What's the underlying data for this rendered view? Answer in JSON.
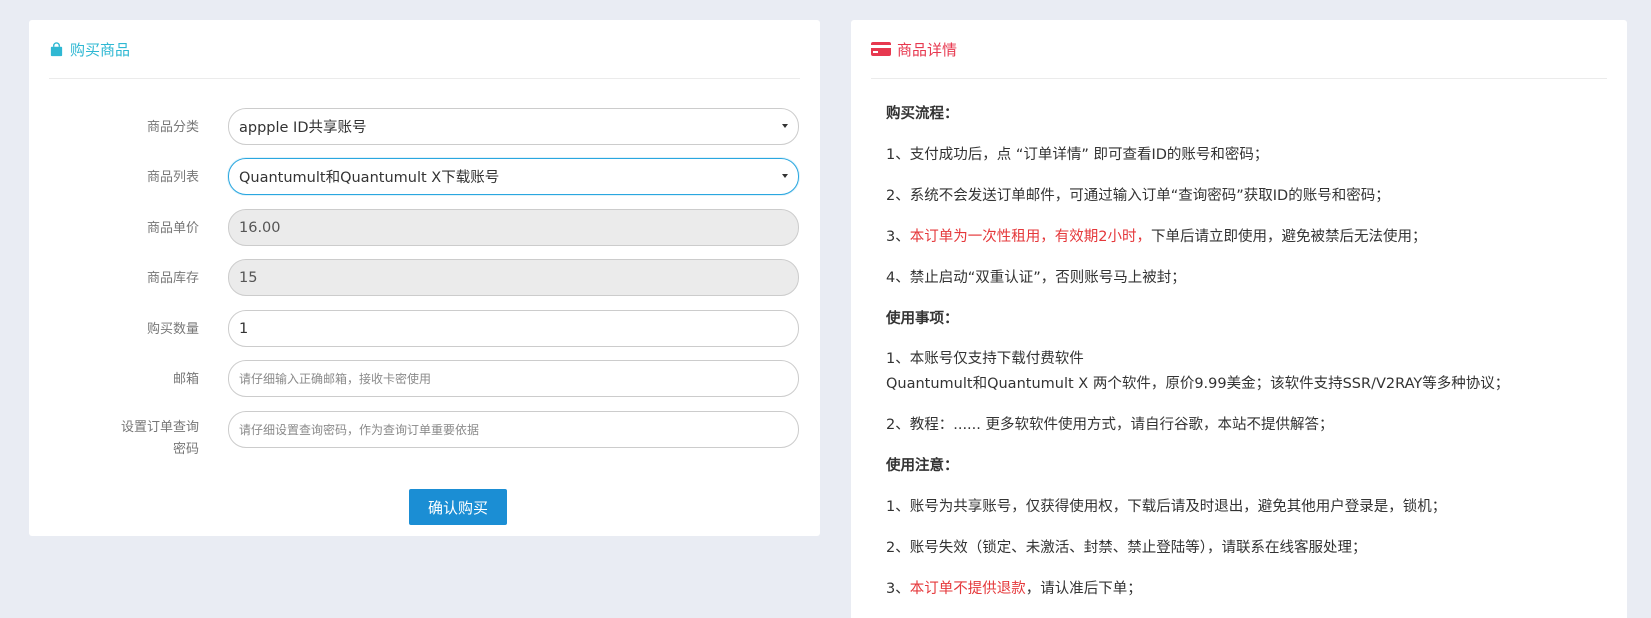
{
  "left_panel": {
    "title": "购买商品",
    "title_icon": "shopping-bag-icon",
    "fields": [
      {
        "label": "商品分类",
        "value": "appple ID共享账号",
        "type": "select"
      },
      {
        "label": "商品列表",
        "value": "Quantumult和Quantumult X下载账号",
        "type": "select"
      },
      {
        "label": "商品单价",
        "value": "16.00",
        "type": "readonly"
      },
      {
        "label": "商品库存",
        "value": "15",
        "type": "readonly"
      },
      {
        "label": "购买数量",
        "value": "1",
        "type": "input"
      },
      {
        "label": "邮箱",
        "placeholder": "请仔细输入正确邮箱，接收卡密使用",
        "type": "input"
      },
      {
        "label_line1": "设置订单查询",
        "label_line2": "密码",
        "placeholder": "请仔细设置查询密码，作为查询订单重要依据",
        "type": "input"
      }
    ],
    "submit_label": "确认购买"
  },
  "right_panel": {
    "title": "商品详情",
    "title_icon": "credit-card-icon",
    "sections": {
      "process_heading": "购买流程：",
      "process_1": "1、支付成功后，点 “订单详情” 即可查看ID的账号和密码；",
      "process_2": "2、系统不会发送订单邮件，可通过输入订单“查询密码”获取ID的账号和密码；",
      "process_3_prefix": "3、",
      "process_3_red": "本订单为一次性租用，有效期2小时，",
      "process_3_rest": "下单后请立即使用，避免被禁后无法使用；",
      "process_4": "4、禁止启动“双重认证”，否则账号马上被封；",
      "usage_heading": "使用事项：",
      "usage_1a": "1、本账号仅支持下载付费软件",
      "usage_1b": "Quantumult和Quantumult X 两个软件，原价9.99美金；该软件支持SSR/V2RAY等多种协议；",
      "usage_2": "2、教程：...... 更多软软件使用方式，请自行谷歌，本站不提供解答；",
      "notice_heading": "使用注意：",
      "notice_1": "1、账号为共享账号，仅获得使用权，下载后请及时退出，避免其他用户登录是，锁机；",
      "notice_2": "2、账号失效（锁定、未激活、封禁、禁止登陆等），请联系在线客服处理；",
      "notice_3_prefix": "3、",
      "notice_3_red": "本订单不提供退款",
      "notice_3_rest": "，请认准后下单；"
    }
  },
  "colors": {
    "left_title": "#2fb8d3",
    "right_title": "#e7384f",
    "button": "#1b8ed4",
    "highlight_red": "#e5383b"
  }
}
